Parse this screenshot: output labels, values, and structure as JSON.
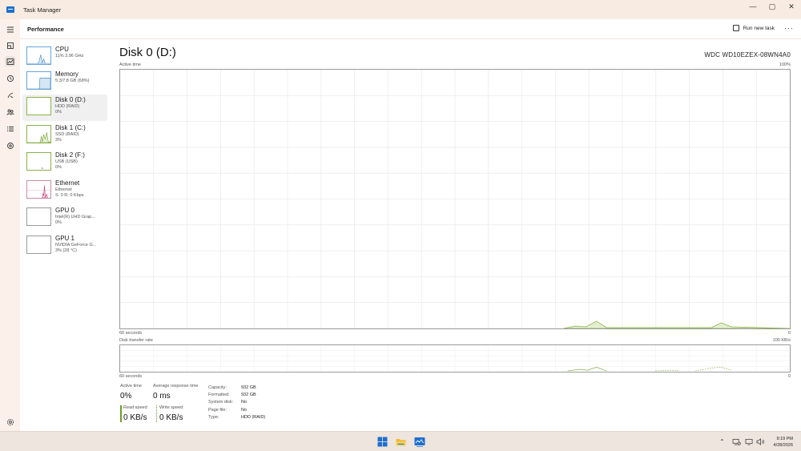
{
  "window": {
    "title": "Task Manager",
    "minimize": "—",
    "maximize": "▢",
    "close": "✕"
  },
  "header": {
    "title": "Performance",
    "run_task": "Run new task",
    "more": "···"
  },
  "devices": [
    {
      "name": "CPU",
      "line2": "11%  3.96 GHz",
      "line3": ""
    },
    {
      "name": "Memory",
      "line2": "5.3/7.8 GB (68%)",
      "line3": ""
    },
    {
      "name": "Disk 0 (D:)",
      "line2": "HDD (RAID)",
      "line3": "0%"
    },
    {
      "name": "Disk 1 (C:)",
      "line2": "SSD (RAID)",
      "line3": "3%"
    },
    {
      "name": "Disk 2 (F:)",
      "line2": "USB (USB)",
      "line3": "0%"
    },
    {
      "name": "Ethernet",
      "line2": "Ethernet",
      "line3": "S: 0  R: 0 Kbps"
    },
    {
      "name": "GPU 0",
      "line2": "Intel(R) UHD Grap...",
      "line3": "0%"
    },
    {
      "name": "GPU 1",
      "line2": "NVIDIA GeForce G...",
      "line3": "3%  (28 °C)"
    }
  ],
  "detail": {
    "title": "Disk 0 (D:)",
    "model": "WDC WD10EZEX-08WN4A0",
    "active_time_label": "Active time",
    "active_time_max": "100%",
    "x_left": "60 seconds",
    "x_right": "0",
    "transfer_label": "Disk transfer rate",
    "transfer_max": "100 KB/s",
    "x_left2": "60 seconds",
    "x_right2": "0"
  },
  "stats": {
    "active_time_label": "Active time",
    "active_time_value": "0%",
    "avg_resp_label": "Average response time",
    "avg_resp_value": "0 ms",
    "read_label": "Read speed",
    "read_value": "0 KB/s",
    "write_label": "Write speed",
    "write_value": "0 KB/s"
  },
  "properties": [
    {
      "key": "Capacity:",
      "value": "932 GB"
    },
    {
      "key": "Formatted:",
      "value": "932 GB"
    },
    {
      "key": "System disk:",
      "value": "No"
    },
    {
      "key": "Page file:",
      "value": "No"
    },
    {
      "key": "Type:",
      "value": "HDD (RAID)"
    }
  ],
  "clock": {
    "time": "9:19 PM",
    "date": "4/28/2026"
  },
  "colors": {
    "disk_green": "#8cb04a",
    "disk_fill": "#e4efd2",
    "accent_blue": "#1e6fd0",
    "ethernet_pink": "#c0306b"
  }
}
